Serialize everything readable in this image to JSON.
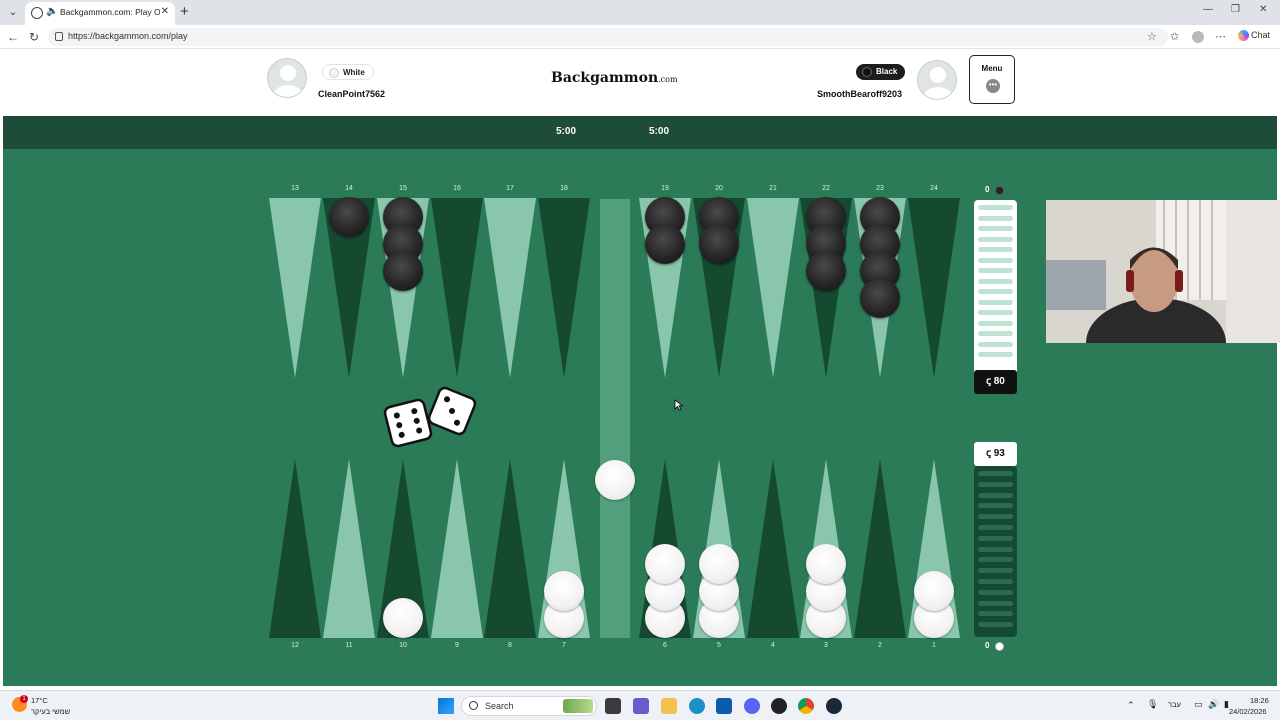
{
  "browser": {
    "tab_title": "Backgammon.com: Play Online",
    "url": "https://backgammon.com/play",
    "copilot_label": "Chat"
  },
  "header": {
    "logo_main": "Backgammon",
    "logo_suffix": ".com",
    "menu_label": "Menu",
    "player_left": {
      "color_label": "White",
      "name": "CleanPoint7562"
    },
    "player_right": {
      "color_label": "Black",
      "name": "SmoothBearoff9203"
    }
  },
  "timers": {
    "left": "5:00",
    "right": "5:00"
  },
  "board": {
    "top_point_numbers": [
      "13",
      "14",
      "15",
      "16",
      "17",
      "18",
      "19",
      "20",
      "21",
      "22",
      "23",
      "24"
    ],
    "bottom_point_numbers": [
      "12",
      "11",
      "10",
      "9",
      "8",
      "7",
      "6",
      "5",
      "4",
      "3",
      "2",
      "1"
    ],
    "checkers": {
      "black": {
        "14": 1,
        "15": 3,
        "19": 2,
        "20": 2,
        "22": 3,
        "23": 4
      },
      "white": {
        "10": 1,
        "7": 2,
        "6": 3,
        "5": 3,
        "3": 3,
        "1": 2,
        "bar": 1
      }
    },
    "dice": [
      6,
      3
    ],
    "pip_black": "80",
    "pip_white": "93",
    "borne_off_black": "0",
    "borne_off_white": "0"
  },
  "taskbar": {
    "weather_temp": "17°C",
    "weather_text": "שמשי בעיקר",
    "search_label": "Search",
    "lang": "עבר",
    "time": "18:26",
    "date": "24/02/2026"
  },
  "colors": {
    "felt": "#2b7a58",
    "dark_triangle": "#154a31",
    "light_triangle": "#8ac6ab",
    "timer_bar": "#1d4d38"
  }
}
